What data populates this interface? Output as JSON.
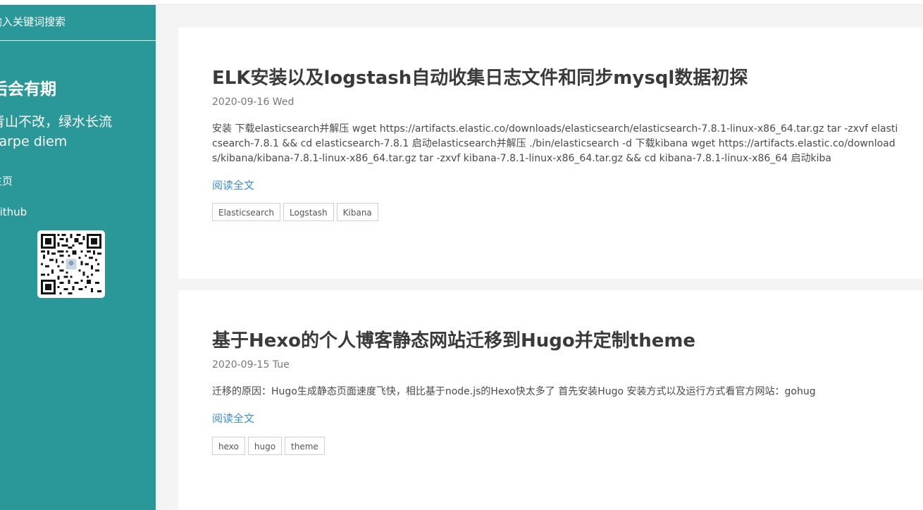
{
  "search": {
    "placeholder": "输入关键词搜索"
  },
  "sidebar": {
    "site_title": "后会有期",
    "motto_line1": "青山不改，绿水长流",
    "motto_line2": "carpe diem",
    "nav": [
      {
        "label": "主页"
      },
      {
        "label": "Github"
      }
    ],
    "qr_icon": "qr-code-icon"
  },
  "posts": [
    {
      "title": "ELK安装以及logstash自动收集日志文件和同步mysql数据初探",
      "date": "2020-09-16 Wed",
      "summary": "安装 下载elasticsearch并解压 wget https://artifacts.elastic.co/downloads/elasticsearch/elasticsearch-7.8.1-linux-x86_64.tar.gz tar -zxvf elasticsearch-7.8.1 && cd elasticsearch-7.8.1 启动elasticsearch并解压 ./bin/elasticsearch -d 下载kibana wget https://artifacts.elastic.co/downloads/kibana/kibana-7.8.1-linux-x86_64.tar.gz tar -zxvf kibana-7.8.1-linux-x86_64.tar.gz && cd kibana-7.8.1-linux-x86_64 启动kiba",
      "read_more": "阅读全文",
      "tags": [
        "Elasticsearch",
        "Logstash",
        "Kibana"
      ]
    },
    {
      "title": "基于Hexo的个人博客静态网站迁移到Hugo并定制theme",
      "date": "2020-09-15 Tue",
      "summary": "迁移的原因：Hugo生成静态页面速度飞快，相比基于node.js的Hexo快太多了 首先安装Hugo 安装方式以及运行方式看官方网站：gohug",
      "read_more": "阅读全文",
      "tags": [
        "hexo",
        "hugo",
        "theme"
      ]
    }
  ],
  "colors": {
    "sidebar_bg": "#2a9898",
    "link": "#3b8fd6",
    "page_bg": "#f4f4f4"
  }
}
